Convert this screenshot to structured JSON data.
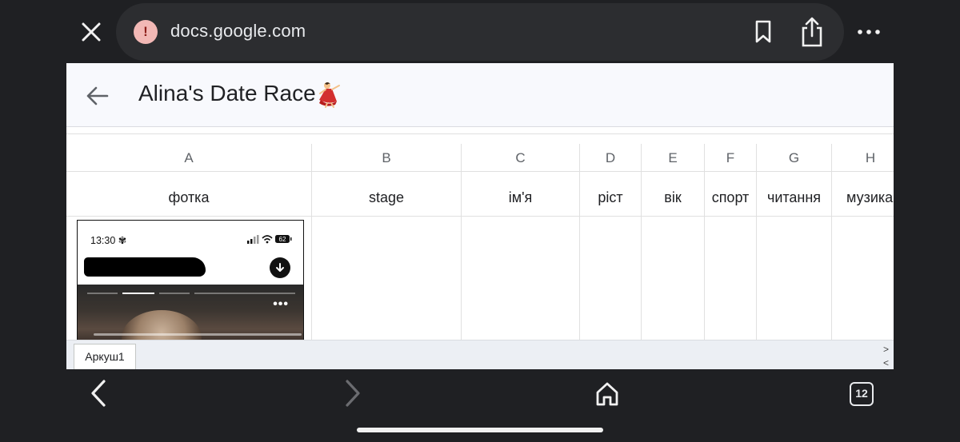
{
  "browser": {
    "url": "docs.google.com",
    "tab_count": "12",
    "icons": [
      "close-icon",
      "warning-icon",
      "bookmark-icon",
      "share-icon",
      "more-icon",
      "back-icon",
      "forward-icon",
      "home-icon",
      "tabs-icon"
    ]
  },
  "document": {
    "title": "Alina's Date Race",
    "title_emoji": "dancer-icon"
  },
  "sheet": {
    "columns": [
      "A",
      "B",
      "C",
      "D",
      "E",
      "F",
      "G",
      "H"
    ],
    "headers": [
      "фотка",
      "stage",
      "ім'я",
      "ріст",
      "вік",
      "спорт",
      "читання",
      "музика"
    ],
    "tab_label": "Аркуш1",
    "tab_next": ">",
    "tab_prev": "<"
  },
  "embedded_screenshot": {
    "time": "13:30",
    "battery": "62"
  },
  "colors": {
    "browser_bg": "#1f2023",
    "url_pill": "#2c2d30",
    "warning": "#f2b8b5",
    "header_bg": "#f8f9fd",
    "gridline": "#e0e0e0"
  }
}
